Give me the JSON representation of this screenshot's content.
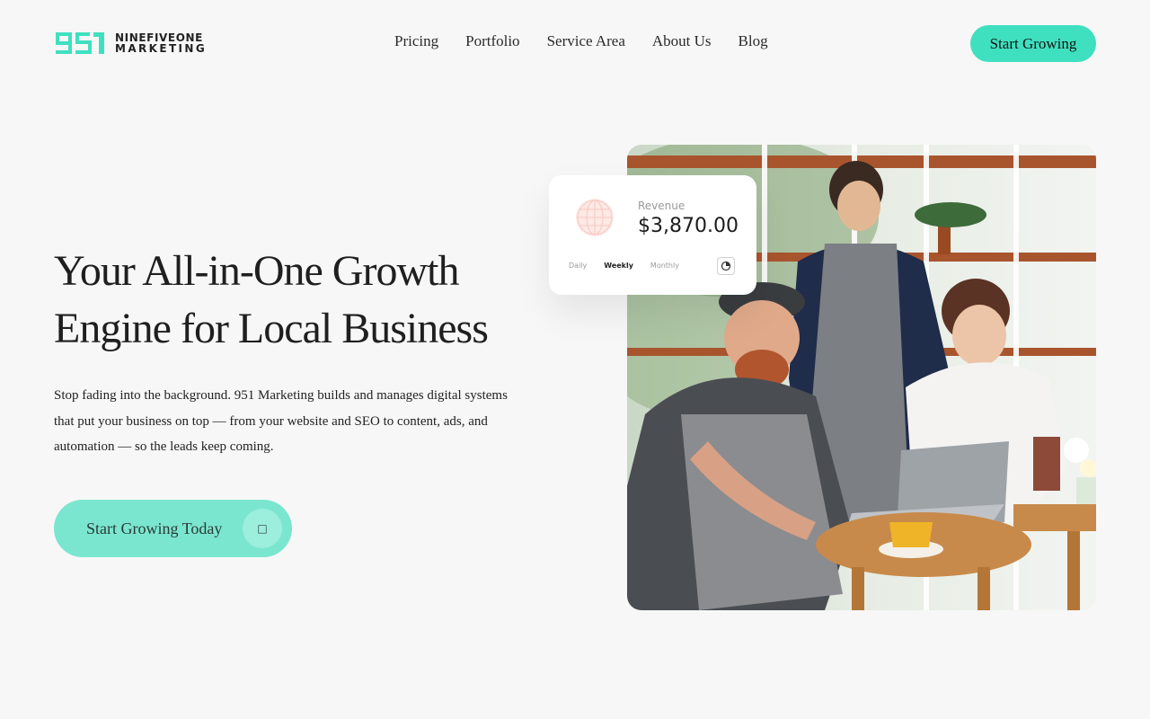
{
  "brand": {
    "mark": "951",
    "line1": "NINEFIVEONE",
    "line2": "MARKETING",
    "accent": "#3fe0c0"
  },
  "nav": {
    "items": [
      "Pricing",
      "Portfolio",
      "Service Area",
      "About Us",
      "Blog"
    ]
  },
  "header": {
    "cta_label": "Start Growing"
  },
  "hero": {
    "title_line1": "Your All-in-One Growth",
    "title_line2": "Engine for Local Business",
    "description": "Stop fading into the background. 951 Marketing builds and manages digital systems that put your business on top — from your website and SEO to content, ads, and automation — so the leads keep coming.",
    "cta_label": "Start Growing Today",
    "cta_icon": "arrow-icon"
  },
  "revenue_card": {
    "label": "Revenue",
    "value": "$3,870.00",
    "tabs": [
      "Daily",
      "Weekly",
      "Monthly"
    ],
    "active_tab": "Weekly",
    "icon": "pie-chart-icon"
  }
}
